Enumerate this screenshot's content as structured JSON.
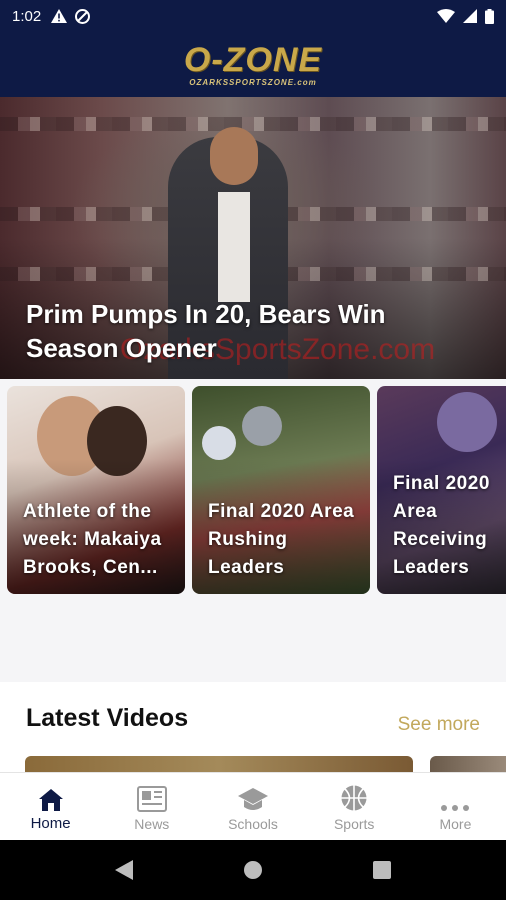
{
  "status_bar": {
    "time": "1:02",
    "icons": [
      "warning-icon",
      "no-disturb-icon",
      "wifi-icon",
      "signal-icon",
      "battery-icon"
    ]
  },
  "header": {
    "logo_main": "O-ZONE",
    "logo_sub": "OZARKSSPORTSZONE.com"
  },
  "hero": {
    "title": "Prim Pumps In 20, Bears Win Season Opener",
    "watermark": "OzarksSportsZone.com"
  },
  "cards": [
    {
      "title": "Athlete of the week: Makaiya Brooks, Cen..."
    },
    {
      "title": "Final 2020 Area Rushing Leaders"
    },
    {
      "title": "Final 2020 Area Receiving Leaders"
    }
  ],
  "videos": {
    "title": "Latest Videos",
    "see_more": "See more"
  },
  "nav": {
    "items": [
      {
        "label": "Home",
        "icon": "home-icon",
        "active": true
      },
      {
        "label": "News",
        "icon": "news-icon",
        "active": false
      },
      {
        "label": "Schools",
        "icon": "schools-icon",
        "active": false
      },
      {
        "label": "Sports",
        "icon": "sports-icon",
        "active": false
      },
      {
        "label": "More",
        "icon": "more-icon",
        "active": false
      }
    ]
  },
  "colors": {
    "navy": "#0e1a45",
    "gold": "#c9a84a",
    "see_more": "#c2a85c"
  }
}
